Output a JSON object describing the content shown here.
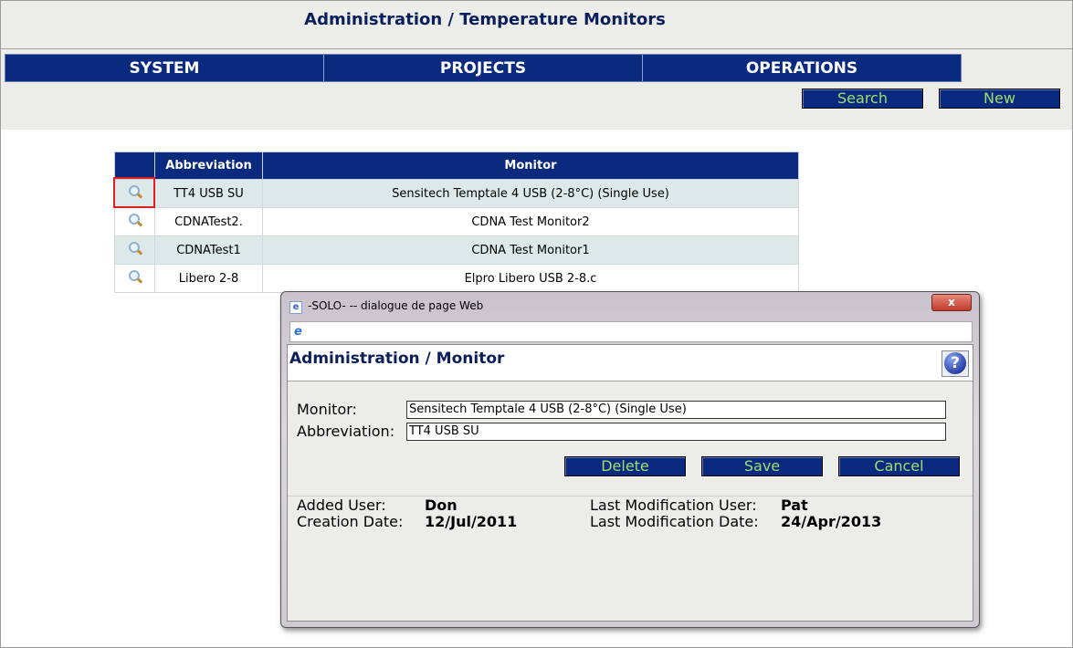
{
  "header": {
    "title": "Administration / Temperature Monitors"
  },
  "menu": [
    {
      "label": "SYSTEM"
    },
    {
      "label": "PROJECTS"
    },
    {
      "label": "OPERATIONS"
    }
  ],
  "toolbar": {
    "search_label": "Search",
    "new_label": "New"
  },
  "table": {
    "columns": [
      "",
      "Abbreviation",
      "Monitor"
    ],
    "rows": [
      {
        "abbreviation": "TT4 USB SU",
        "monitor": "Sensitech Temptale 4 USB (2-8°C) (Single Use)"
      },
      {
        "abbreviation": "CDNATest2.",
        "monitor": "CDNA Test Monitor2"
      },
      {
        "abbreviation": "CDNATest1",
        "monitor": "CDNA Test Monitor1"
      },
      {
        "abbreviation": "Libero 2-8",
        "monitor": "Elpro Libero USB 2-8.c"
      }
    ]
  },
  "dialog": {
    "window_title": "-SOLO- -- dialogue de page Web",
    "close_label": "x",
    "heading": "Administration / Monitor",
    "help_label": "?",
    "monitor_label": "Monitor:",
    "monitor_value": "Sensitech Temptale 4 USB (2-8°C) (Single Use)",
    "abbreviation_label": "Abbreviation:",
    "abbreviation_value": "TT4 USB SU",
    "delete_label": "Delete",
    "save_label": "Save",
    "cancel_label": "Cancel",
    "added_user_label": "Added User:",
    "added_user_value": "Don",
    "creation_date_label": "Creation Date:",
    "creation_date_value": "12/Jul/2011",
    "last_mod_user_label": "Last Modification User:",
    "last_mod_user_value": "Pat",
    "last_mod_date_label": "Last Modification Date:",
    "last_mod_date_value": "24/Apr/2013"
  },
  "colors": {
    "navy": "#0a2a80",
    "button_text": "#9ee06a",
    "title": "#0a1f5c",
    "row_alt": "#dde9e9"
  }
}
